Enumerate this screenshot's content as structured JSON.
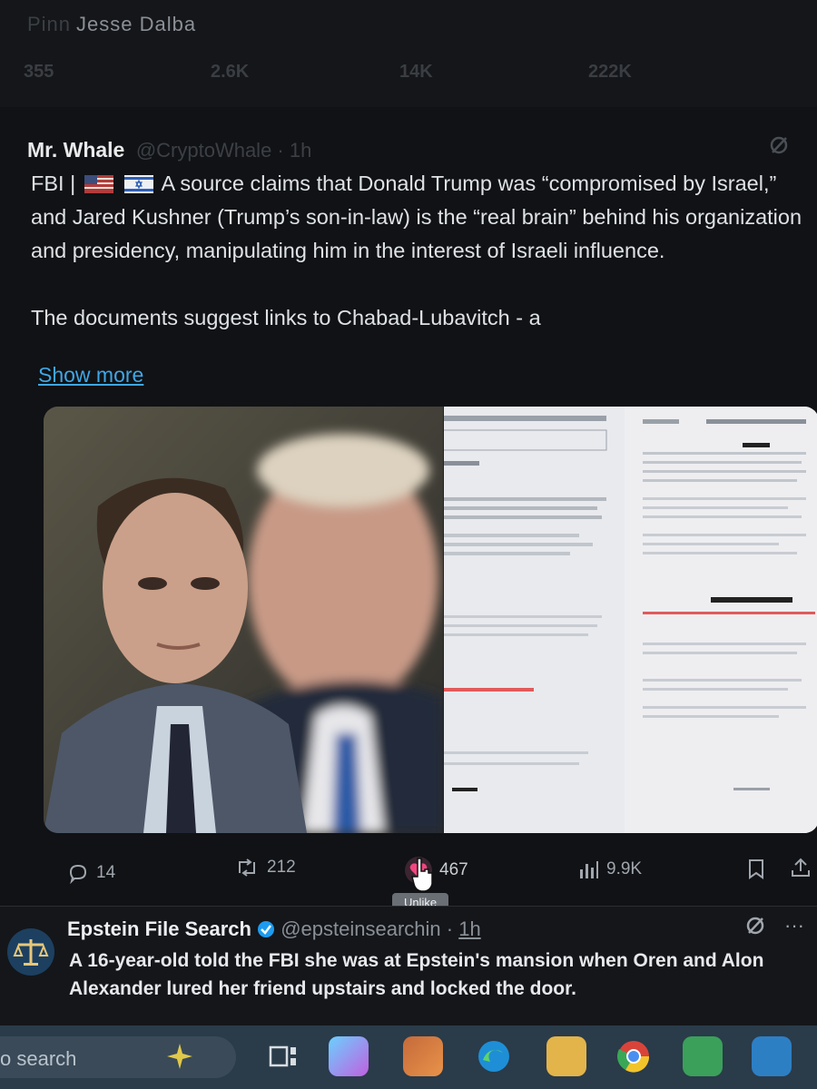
{
  "previous_post": {
    "author": "Jesse Dalba",
    "author_prefix": "Pinn",
    "stats": [
      "355",
      "2.6K",
      "14K",
      "222K"
    ]
  },
  "post": {
    "author_name": "Mr. Whale",
    "author_handle": "@CryptoWhale · 1h",
    "text_prefix": "FBI |",
    "text_body": "A source claims that Donald Trump was “compromised by Israel,” and Jared Kushner (Trump’s son-in-law) is the “real brain” behind his organization and presidency, manipulating him in the interest of Israeli influence.",
    "text_second": "The documents suggest links to Chabad-Lubavitch - a",
    "show_more": "Show more",
    "actions": {
      "replies": "14",
      "reposts": "212",
      "likes": "467",
      "views": "9.9K"
    },
    "like_tooltip": "Unlike"
  },
  "next_post": {
    "author_name": "Epstein File Search",
    "author_handle": "@epsteinsearchin ·",
    "time": "1h",
    "text": "A 16-year-old told the FBI she was at Epstein's mansion when Oren and Alon Alexander lured her friend upstairs and locked the door.",
    "more": "···"
  },
  "taskbar": {
    "search_text": "o search"
  },
  "colors": {
    "accent": "#3fa7e6",
    "like": "#f0467f"
  }
}
